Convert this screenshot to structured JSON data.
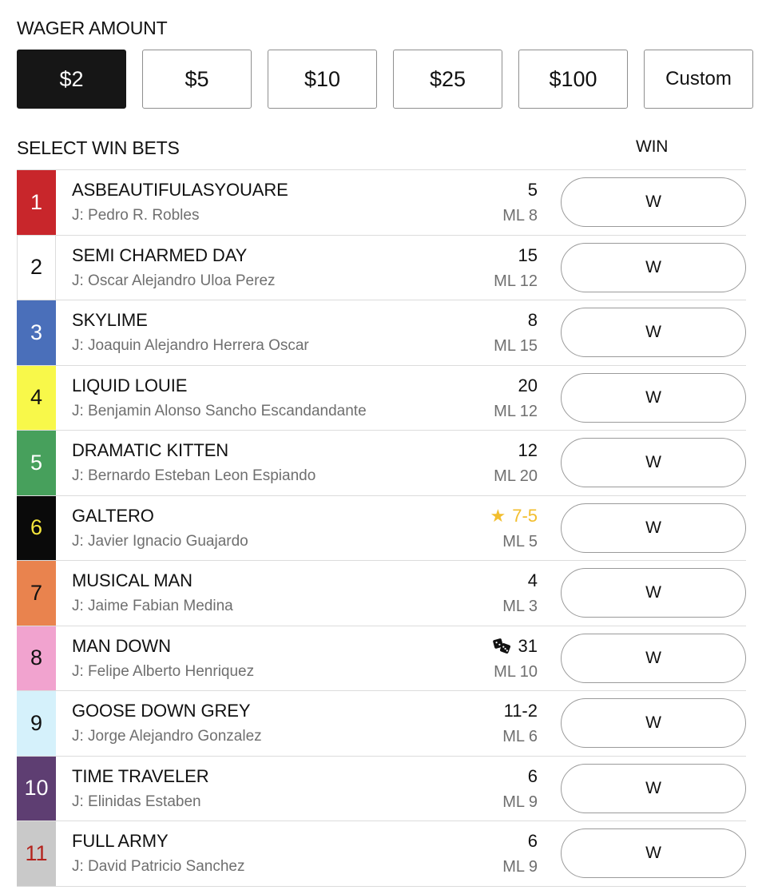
{
  "wager": {
    "heading": "WAGER AMOUNT",
    "amounts": [
      {
        "label": "$2",
        "selected": true
      },
      {
        "label": "$5",
        "selected": false
      },
      {
        "label": "$10",
        "selected": false
      },
      {
        "label": "$25",
        "selected": false
      },
      {
        "label": "$100",
        "selected": false
      },
      {
        "label": "Custom",
        "selected": false
      }
    ]
  },
  "win_bets": {
    "heading": "SELECT WIN BETS",
    "column_label": "WIN",
    "button_label": "W",
    "runners": [
      {
        "number": "1",
        "name": "ASBEAUTIFULASYOUARE",
        "jockey": "J: Pedro R. Robles",
        "odds": "5",
        "morning_line": "ML 8",
        "saddle_bg": "#c8262b",
        "saddle_fg": "#ffffff",
        "favorite": false,
        "icon": ""
      },
      {
        "number": "2",
        "name": "SEMI CHARMED DAY",
        "jockey": "J: Oscar Alejandro Uloa Perez",
        "odds": "15",
        "morning_line": "ML 12",
        "saddle_bg": "#ffffff",
        "saddle_fg": "#111111",
        "favorite": false,
        "icon": ""
      },
      {
        "number": "3",
        "name": "SKYLIME",
        "jockey": "J: Joaquin Alejandro Herrera Oscar",
        "odds": "8",
        "morning_line": "ML 15",
        "saddle_bg": "#4a6fba",
        "saddle_fg": "#ffffff",
        "favorite": false,
        "icon": ""
      },
      {
        "number": "4",
        "name": "LIQUID LOUIE",
        "jockey": "J: Benjamin Alonso Sancho Escandandante",
        "odds": "20",
        "morning_line": "ML 12",
        "saddle_bg": "#f8f84a",
        "saddle_fg": "#111111",
        "favorite": false,
        "icon": ""
      },
      {
        "number": "5",
        "name": "DRAMATIC KITTEN",
        "jockey": "J: Bernardo Esteban Leon Espiando",
        "odds": "12",
        "morning_line": "ML 20",
        "saddle_bg": "#47a05c",
        "saddle_fg": "#ffffff",
        "favorite": false,
        "icon": ""
      },
      {
        "number": "6",
        "name": "GALTERO",
        "jockey": "J: Javier Ignacio Guajardo",
        "odds": "7-5",
        "morning_line": "ML 5",
        "saddle_bg": "#0a0a0a",
        "saddle_fg": "#f5e63c",
        "favorite": true,
        "icon": "star-icon"
      },
      {
        "number": "7",
        "name": "MUSICAL MAN",
        "jockey": "J: Jaime Fabian Medina",
        "odds": "4",
        "morning_line": "ML 3",
        "saddle_bg": "#e9834e",
        "saddle_fg": "#111111",
        "favorite": false,
        "icon": ""
      },
      {
        "number": "8",
        "name": "MAN DOWN",
        "jockey": "J: Felipe Alberto Henriquez",
        "odds": "31",
        "morning_line": "ML 10",
        "saddle_bg": "#f1a3cf",
        "saddle_fg": "#111111",
        "favorite": false,
        "icon": "dice-icon"
      },
      {
        "number": "9",
        "name": "GOOSE DOWN GREY",
        "jockey": "J: Jorge Alejandro Gonzalez",
        "odds": "11-2",
        "morning_line": "ML 6",
        "saddle_bg": "#d5f1fb",
        "saddle_fg": "#111111",
        "favorite": false,
        "icon": ""
      },
      {
        "number": "10",
        "name": "TIME TRAVELER",
        "jockey": "J: Elinidas Estaben",
        "odds": "6",
        "morning_line": "ML 9",
        "saddle_bg": "#5e3e72",
        "saddle_fg": "#ffffff",
        "favorite": false,
        "icon": ""
      },
      {
        "number": "11",
        "name": "FULL ARMY",
        "jockey": "J: David Patricio Sanchez",
        "odds": "6",
        "morning_line": "ML 9",
        "saddle_bg": "#c9c9c9",
        "saddle_fg": "#b4231d",
        "favorite": false,
        "icon": ""
      }
    ]
  }
}
